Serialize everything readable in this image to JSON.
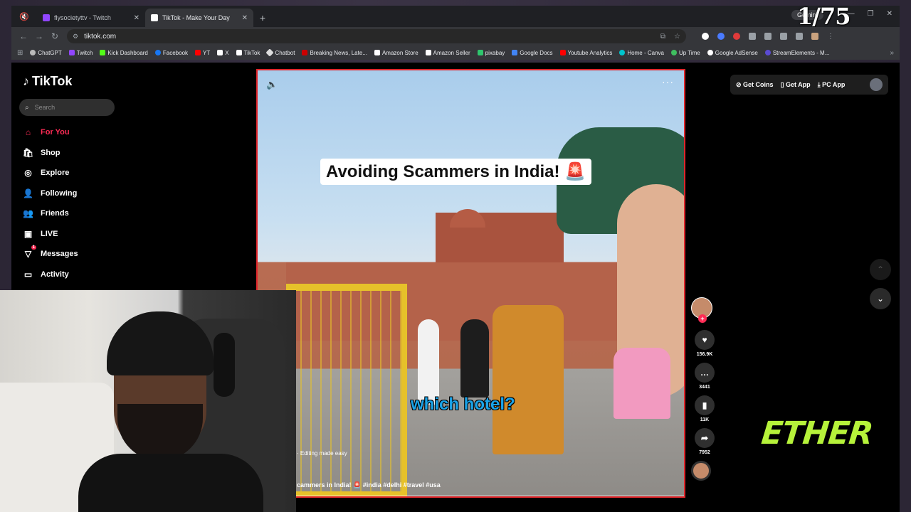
{
  "overlay": {
    "counter": "1/75",
    "brand": "ETHER",
    "gemini_label": "Gemini"
  },
  "browser": {
    "tabs": [
      {
        "title": "flysocietyttv - Twitch",
        "active": false,
        "color": "#9146ff"
      },
      {
        "title": "TikTok - Make Your Day",
        "active": true,
        "color": "#ffffff"
      }
    ],
    "url": "tiktok.com",
    "bookmarks": [
      {
        "label": "ChatGPT",
        "color": "#bbbbbb"
      },
      {
        "label": "Twitch",
        "color": "#9146ff"
      },
      {
        "label": "Kick Dashboard",
        "color": "#53fc18"
      },
      {
        "label": "Facebook",
        "color": "#1877f2"
      },
      {
        "label": "YT",
        "color": "#ff0000"
      },
      {
        "label": "X",
        "color": "#ffffff"
      },
      {
        "label": "TikTok",
        "color": "#ffffff"
      },
      {
        "label": "Chatbot",
        "color": "#dddddd"
      },
      {
        "label": "Breaking News, Late...",
        "color": "#cc0000"
      },
      {
        "label": "Amazon Store",
        "color": "#ffffff"
      },
      {
        "label": "Amazon Seller",
        "color": "#ffffff"
      },
      {
        "label": "pixabay",
        "color": "#2ec66d"
      },
      {
        "label": "Google Docs",
        "color": "#4285f4"
      },
      {
        "label": "Youtube Analytics",
        "color": "#ff0000"
      },
      {
        "label": "Home - Canva",
        "color": "#00c4cc"
      },
      {
        "label": "Up Time",
        "color": "#3fbf5f"
      },
      {
        "label": "Google AdSense",
        "color": "#ffffff"
      },
      {
        "label": "StreamElements - M...",
        "color": "#5a4bd1"
      }
    ]
  },
  "tiktok": {
    "logo": "TikTok",
    "search_placeholder": "Search",
    "nav": [
      {
        "label": "For You",
        "icon": "home-icon",
        "active": true
      },
      {
        "label": "Shop",
        "icon": "shop-icon",
        "active": false
      },
      {
        "label": "Explore",
        "icon": "compass-icon",
        "active": false
      },
      {
        "label": "Following",
        "icon": "following-icon",
        "active": false
      },
      {
        "label": "Friends",
        "icon": "friends-icon",
        "active": false
      },
      {
        "label": "LIVE",
        "icon": "live-icon",
        "active": false
      },
      {
        "label": "Messages",
        "icon": "messages-icon",
        "active": false,
        "badge": "1"
      },
      {
        "label": "Activity",
        "icon": "activity-icon",
        "active": false
      }
    ],
    "topbar": {
      "coins": "Get Coins",
      "app": "Get App",
      "pc_app": "PC App"
    },
    "video": {
      "title": "Avoiding Scammers in India! 🚨",
      "subtitle": "which hotel?",
      "editing_tag": "· Editing made easy",
      "caption": "cammers in India! 🚨 #india #delhi #travel #usa",
      "progress": 0.0
    },
    "stats": {
      "likes": "156.9K",
      "comments": "3441",
      "saves": "11K",
      "shares": "7952"
    }
  }
}
